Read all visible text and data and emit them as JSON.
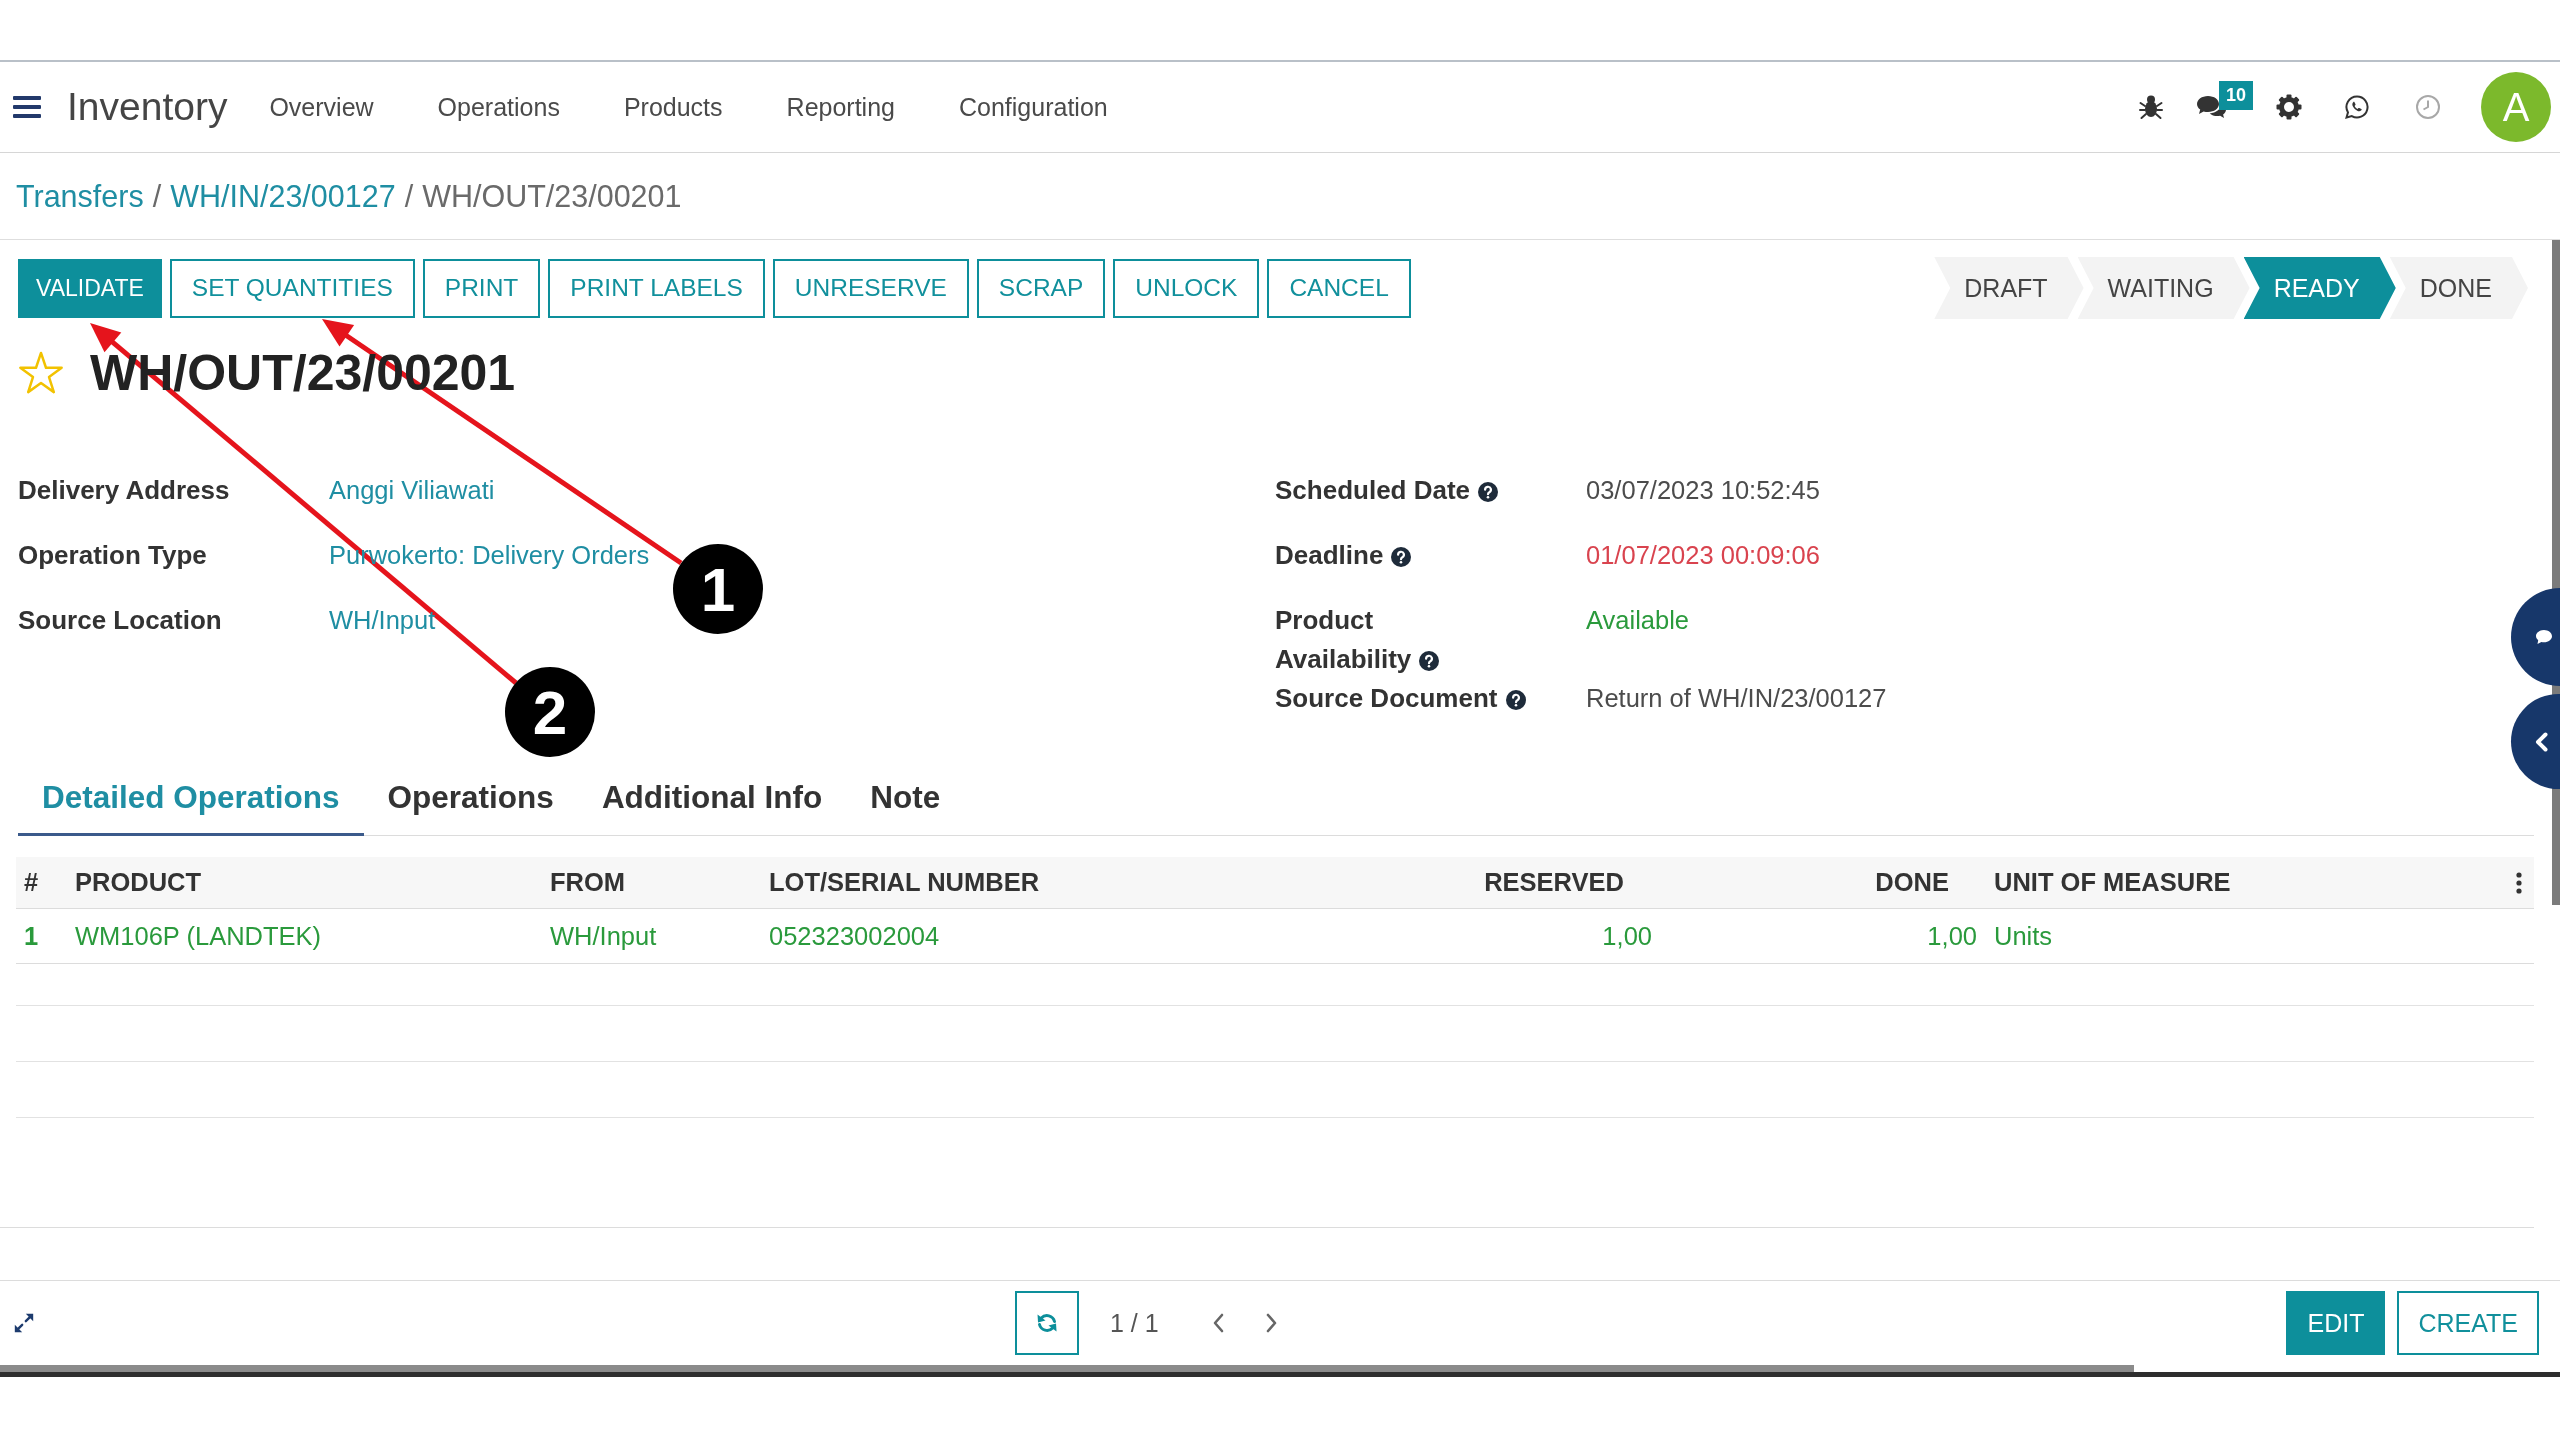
{
  "navbar": {
    "app_name": "Inventory",
    "menu": [
      "Overview",
      "Operations",
      "Products",
      "Reporting",
      "Configuration"
    ],
    "message_count": "10",
    "avatar_initial": "A"
  },
  "breadcrumb": {
    "separator": "/",
    "items": [
      {
        "label": "Transfers",
        "current": false
      },
      {
        "label": "WH/IN/23/00127",
        "current": false
      },
      {
        "label": "WH/OUT/23/00201",
        "current": true
      }
    ]
  },
  "actions": [
    {
      "label": "VALIDATE",
      "kind": "primary"
    },
    {
      "label": "SET QUANTITIES",
      "kind": "secondary"
    },
    {
      "label": "PRINT",
      "kind": "secondary"
    },
    {
      "label": "PRINT LABELS",
      "kind": "secondary"
    },
    {
      "label": "UNRESERVE",
      "kind": "secondary"
    },
    {
      "label": "SCRAP",
      "kind": "secondary"
    },
    {
      "label": "UNLOCK",
      "kind": "secondary"
    },
    {
      "label": "CANCEL",
      "kind": "secondary"
    }
  ],
  "status_steps": [
    {
      "label": "DRAFT",
      "selected": false
    },
    {
      "label": "WAITING",
      "selected": false
    },
    {
      "label": "READY",
      "selected": true
    },
    {
      "label": "DONE",
      "selected": false
    }
  ],
  "record": {
    "title": "WH/OUT/23/00201",
    "starred": false
  },
  "fields_left": [
    {
      "label": "Delivery Address",
      "value": "Anggi Viliawati",
      "kind": "link"
    },
    {
      "label": "Operation Type",
      "value": "Purwokerto: Delivery Orders",
      "kind": "link"
    },
    {
      "label": "Source Location",
      "value": "WH/Input",
      "kind": "link"
    }
  ],
  "fields_right": [
    {
      "label": "Scheduled Date",
      "help": true,
      "value": "03/07/2023 10:52:45",
      "kind": "plain"
    },
    {
      "label": "Deadline",
      "help": true,
      "value": "01/07/2023 00:09:06",
      "kind": "overdue"
    },
    {
      "label": "Product Availability",
      "help": true,
      "value": "Available",
      "kind": "available"
    },
    {
      "label": "Source Document",
      "help": true,
      "value": "Return of WH/IN/23/00127",
      "kind": "plain"
    }
  ],
  "tabs": [
    {
      "label": "Detailed Operations",
      "selected": true
    },
    {
      "label": "Operations",
      "selected": false
    },
    {
      "label": "Additional Info",
      "selected": false
    },
    {
      "label": "Note",
      "selected": false
    }
  ],
  "table": {
    "columns": [
      {
        "label": "#",
        "kind": "text"
      },
      {
        "label": "PRODUCT",
        "kind": "text"
      },
      {
        "label": "FROM",
        "kind": "text"
      },
      {
        "label": "LOT/SERIAL NUMBER",
        "kind": "text"
      },
      {
        "label": "RESERVED",
        "kind": "number"
      },
      {
        "label": "DONE",
        "kind": "number"
      },
      {
        "label": "UNIT OF MEASURE",
        "kind": "text"
      }
    ],
    "rows": [
      {
        "kind": "success",
        "cells": [
          "1",
          "WM106P (LANDTEK)",
          "WH/Input",
          "052323002004",
          "1,00",
          "1,00",
          "Units"
        ]
      }
    ]
  },
  "pager": {
    "value": "1 / 1"
  },
  "bottom_actions": [
    {
      "label": "EDIT",
      "kind": "primary"
    },
    {
      "label": "CREATE",
      "kind": "secondary"
    }
  ],
  "annotations": [
    {
      "number": "1"
    },
    {
      "number": "2"
    }
  ]
}
